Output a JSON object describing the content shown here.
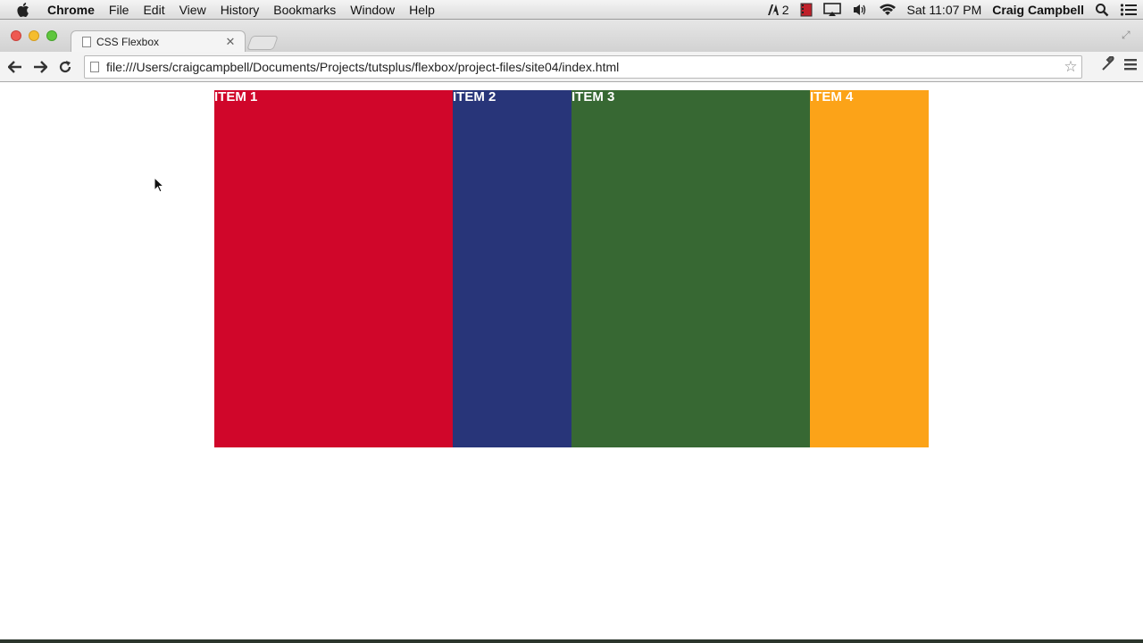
{
  "menubar": {
    "app_name": "Chrome",
    "items": [
      "File",
      "Edit",
      "View",
      "History",
      "Bookmarks",
      "Window",
      "Help"
    ],
    "status": {
      "adobe_count": "2",
      "clock": "Sat 11:07 PM",
      "user": "Craig Campbell"
    }
  },
  "browser": {
    "tab_title": "CSS Flexbox",
    "url": "file:///Users/craigcampbell/Documents/Projects/tutsplus/flexbox/project-files/site04/index.html"
  },
  "page": {
    "items": [
      {
        "label": "ITEM 1",
        "color": "#d0062a"
      },
      {
        "label": "ITEM 2",
        "color": "#283579"
      },
      {
        "label": "ITEM 3",
        "color": "#376833"
      },
      {
        "label": "ITEM 4",
        "color": "#fca318"
      }
    ]
  }
}
